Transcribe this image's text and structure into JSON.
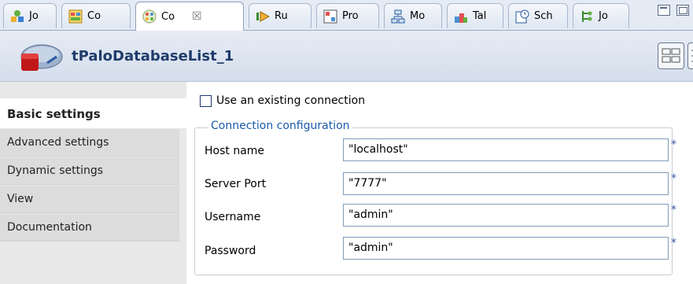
{
  "tabs": [
    {
      "label": "Jo",
      "icon": "job-icon",
      "active": false
    },
    {
      "label": "Co",
      "icon": "contexts-icon",
      "active": false
    },
    {
      "label": "Co",
      "icon": "component-icon",
      "active": true
    },
    {
      "label": "Ru",
      "icon": "run-icon",
      "active": false
    },
    {
      "label": "Pro",
      "icon": "problems-icon",
      "active": false
    },
    {
      "label": "Mo",
      "icon": "modules-icon",
      "active": false
    },
    {
      "label": "Tal",
      "icon": "talend-exchange-icon",
      "active": false
    },
    {
      "label": "Sch",
      "icon": "scheduler-icon",
      "active": false
    },
    {
      "label": "Jo",
      "icon": "jobscript-icon",
      "active": false
    }
  ],
  "component": {
    "title": "tPaloDatabaseList_1"
  },
  "nav": {
    "items": [
      {
        "label": "Basic settings",
        "active": true
      },
      {
        "label": "Advanced settings",
        "active": false
      },
      {
        "label": "Dynamic settings",
        "active": false
      },
      {
        "label": "View",
        "active": false
      },
      {
        "label": "Documentation",
        "active": false
      }
    ]
  },
  "form": {
    "use_existing_label": "Use an existing connection",
    "use_existing_checked": false,
    "group_title": "Connection configuration",
    "required_mark": "*",
    "fields": [
      {
        "label": "Host name",
        "value": "\"localhost\""
      },
      {
        "label": "Server Port",
        "value": "\"7777\""
      },
      {
        "label": "Username",
        "value": "\"admin\""
      },
      {
        "label": "Password",
        "value": "\"admin\""
      }
    ]
  },
  "colors": {
    "legend": "#1a5aa8",
    "title": "#1f3b6b",
    "required": "#3b57a6"
  }
}
